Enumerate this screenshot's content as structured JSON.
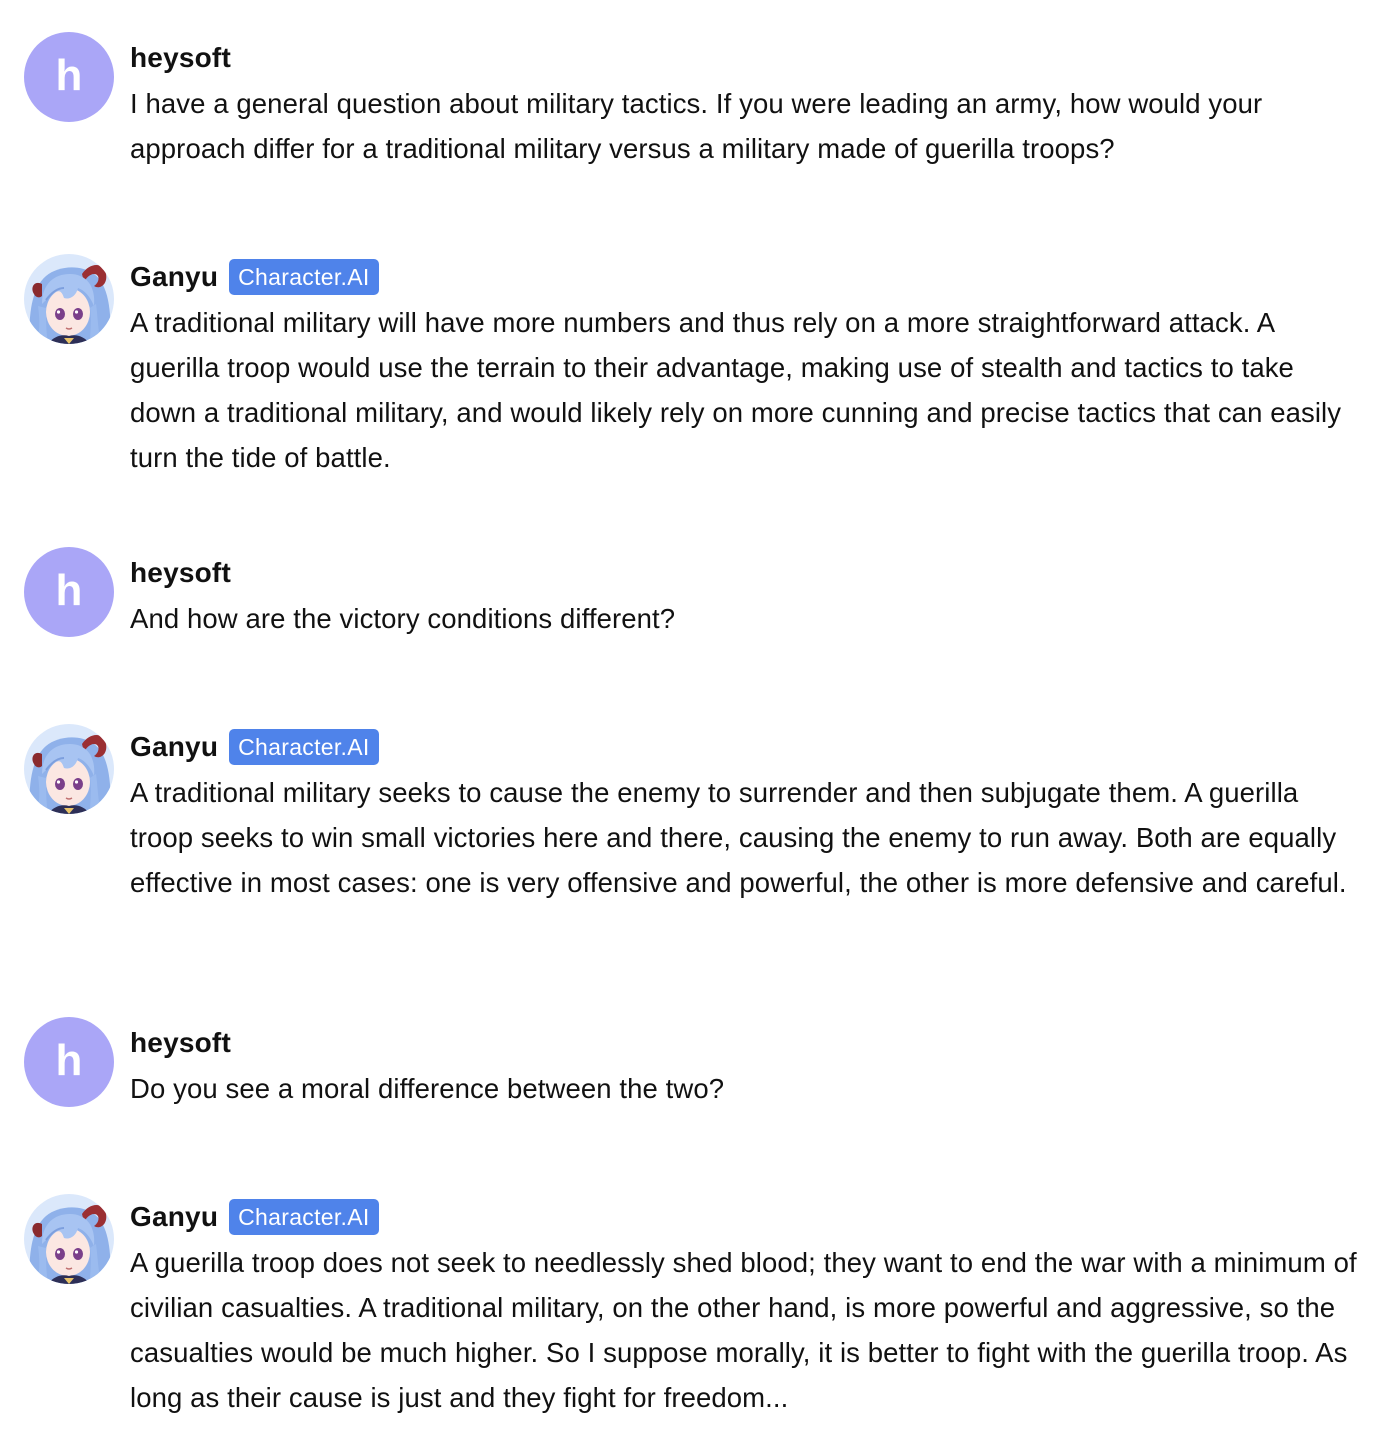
{
  "messages": [
    {
      "author": "heysoft",
      "avatar_letter": "h",
      "text": "I have a general question about military tactics. If you were leading an army, how would your approach differ for a traditional military versus a military made of guerilla troops?"
    },
    {
      "author": "Ganyu",
      "badge": "Character.AI",
      "text": "A traditional military will have more numbers and thus rely on a more straightforward attack. A guerilla troop would use the terrain to their advantage, making use of stealth and tactics to take down a traditional military, and would likely rely on more cunning and precise tactics that can easily turn the tide of battle."
    },
    {
      "author": "heysoft",
      "avatar_letter": "h",
      "text": "And how are the victory conditions different?"
    },
    {
      "author": "Ganyu",
      "badge": "Character.AI",
      "text": "A traditional military seeks to cause the enemy to surrender and then subjugate them. A guerilla troop seeks to win small victories here and there, causing the enemy to run away. Both are equally effective in most cases: one is very offensive and powerful, the other is more defensive and careful."
    },
    {
      "author": "heysoft",
      "avatar_letter": "h",
      "text": "Do you see a moral difference between the two?"
    },
    {
      "author": "Ganyu",
      "badge": "Character.AI",
      "text": "A guerilla troop does not seek to needlessly shed blood; they want to end the war with a minimum of civilian casualties. A traditional military, on the other hand, is more powerful and aggressive, so the casualties would be much higher. So I suppose morally, it is better to fight with the guerilla troop. As long as their cause is just and they fight for freedom..."
    }
  ],
  "colors": {
    "user_avatar": "#aaa6f7",
    "badge": "#4f83ea",
    "text": "#111111",
    "background": "#ffffff"
  }
}
